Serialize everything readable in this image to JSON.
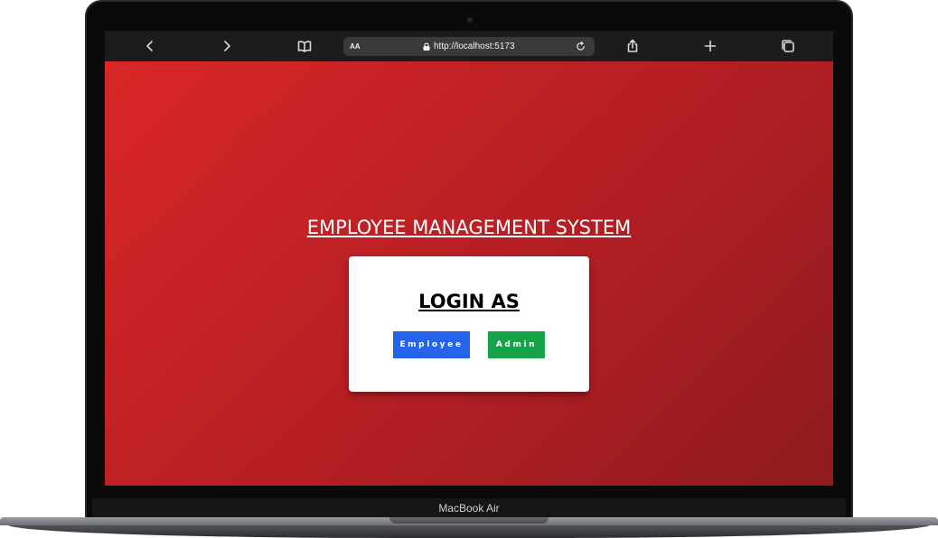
{
  "browser": {
    "address_bar": {
      "text_size_label": "AA",
      "url": "http://localhost:5173"
    },
    "icons": [
      "back-icon",
      "forward-icon",
      "bookmarks-icon",
      "lock-icon",
      "reload-icon",
      "share-icon",
      "new-tab-icon",
      "tabs-icon"
    ]
  },
  "page": {
    "title": "EMPLOYEE MANAGEMENT SYSTEM",
    "login_card": {
      "heading": "LOGIN AS",
      "employee_button": "Employee",
      "admin_button": "Admin"
    },
    "colors": {
      "background_start": "#d92626",
      "background_end": "#8e1b1e",
      "employee_button": "#2563eb",
      "admin_button": "#16a34a"
    }
  },
  "device": {
    "model_label": "MacBook Air"
  }
}
